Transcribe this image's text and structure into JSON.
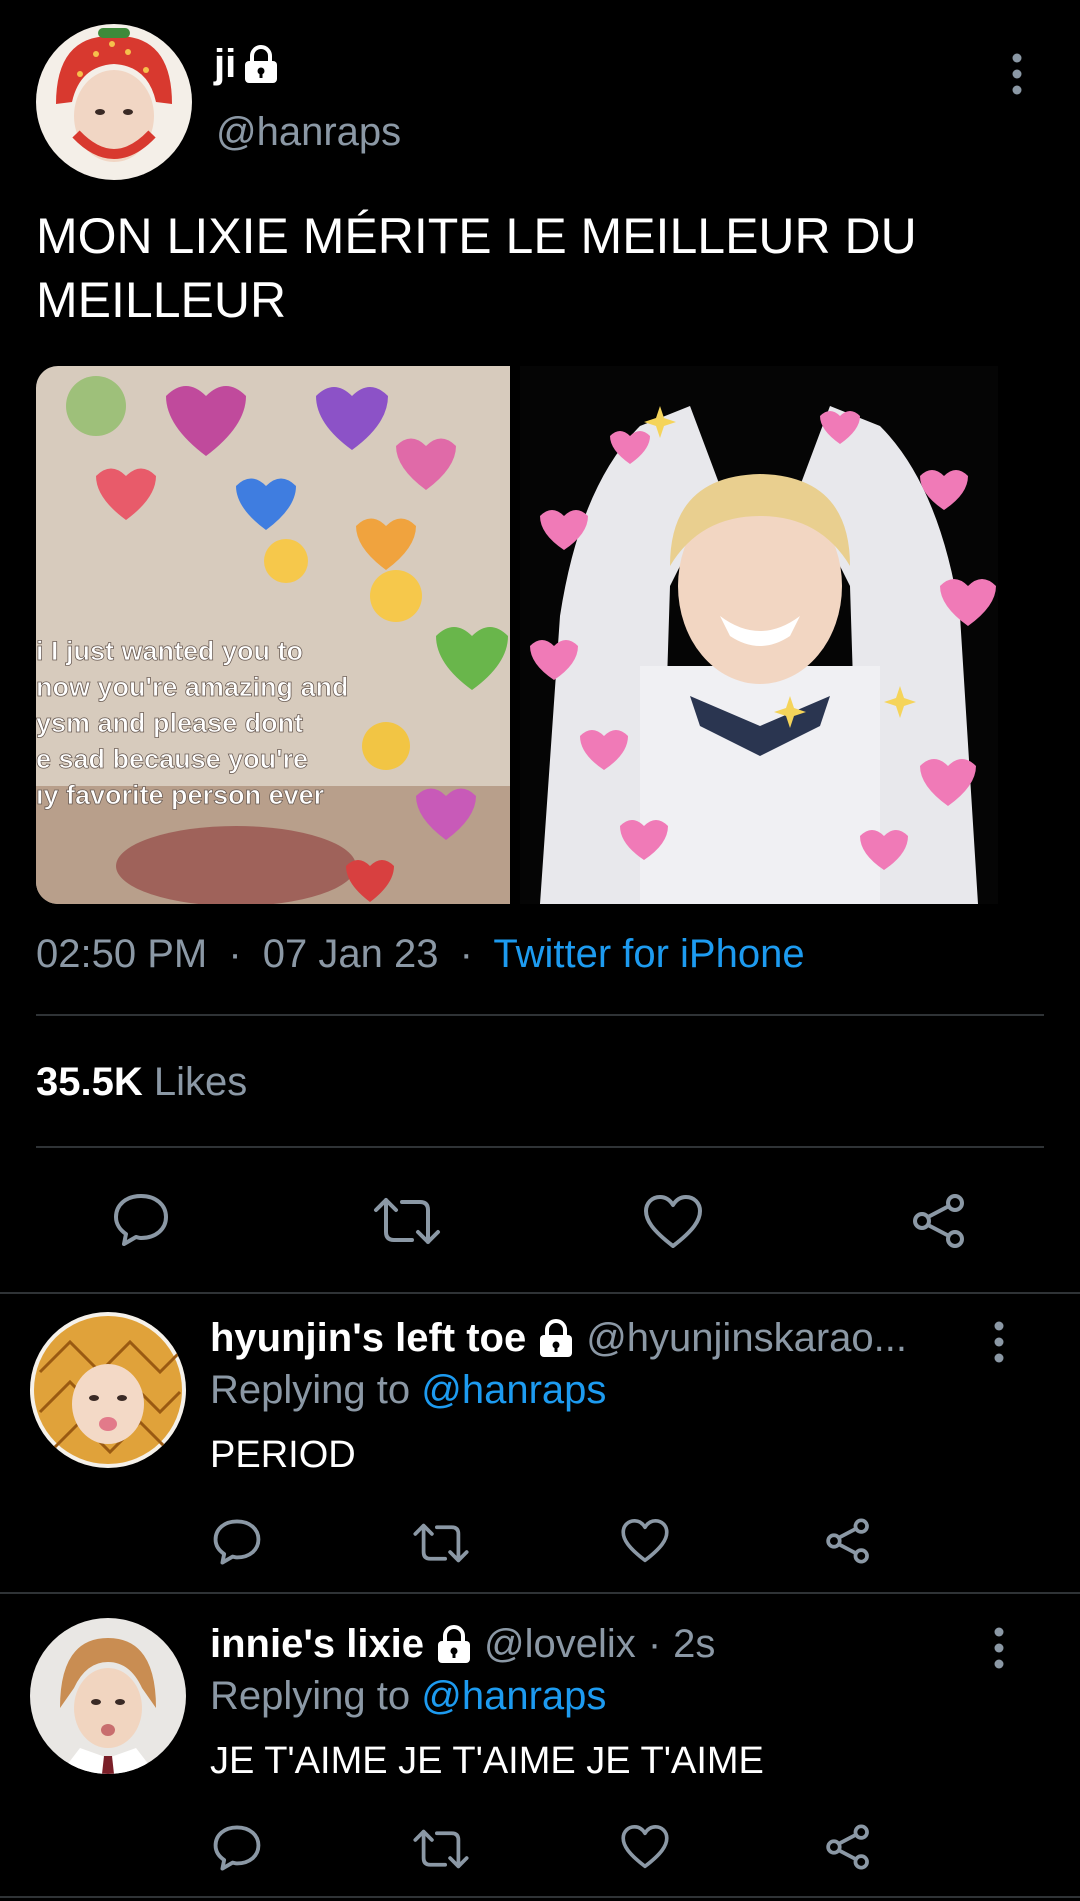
{
  "tweet": {
    "name": "ji",
    "handle": "@hanraps",
    "text": "MON LIXIE MÉRITE LE MEILLEUR DU MEILLEUR",
    "media_caption_lines": [
      "i I just wanted you to",
      "now you're amazing and",
      "ysm and please dont",
      "e sad because you're",
      "ıy favorite person ever"
    ],
    "time": "02:50 PM",
    "date": "07 Jan 23",
    "source": "Twitter for iPhone",
    "likes_count": "35.5K",
    "likes_label": "Likes",
    "separator": "·"
  },
  "replies": [
    {
      "name": "hyunjin's left toe",
      "handle": "@hyunjinskarao...",
      "time": "",
      "replying_label": "Replying to",
      "replying_to": "@hanraps",
      "text": "PERIOD"
    },
    {
      "name": "innie's lixie",
      "handle": "@lovelix",
      "time": "2s",
      "replying_label": "Replying to",
      "replying_to": "@hanraps",
      "text": "JE T'AIME JE T'AIME JE T'AIME"
    }
  ],
  "colors": {
    "background": "#000000",
    "text": "#e7e9ea",
    "muted": "#8b98a5",
    "accent": "#1d9bf0",
    "divider": "#2f3336"
  },
  "icons": [
    "lock-icon",
    "more-vertical-icon",
    "reply-icon",
    "retweet-icon",
    "like-icon",
    "share-icon"
  ]
}
